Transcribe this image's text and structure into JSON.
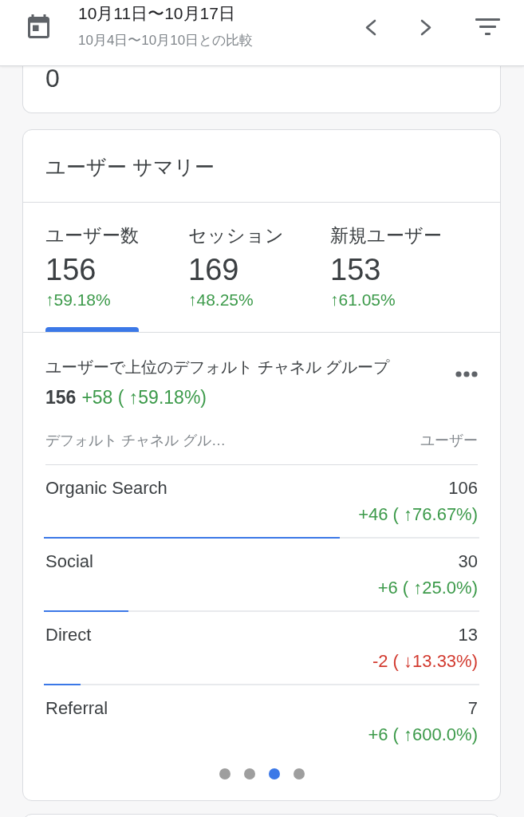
{
  "header": {
    "title": "10月11日〜10月17日",
    "subtitle": "10月4日〜10月10日との比較"
  },
  "previous_card": {
    "value": "0"
  },
  "summary": {
    "title": "ユーザー サマリー",
    "metrics": [
      {
        "label": "ユーザー数",
        "value": "156",
        "change": "↑59.18%",
        "kind": "increase",
        "selected": true
      },
      {
        "label": "セッション",
        "value": "169",
        "change": "↑48.25%",
        "kind": "increase",
        "selected": false
      },
      {
        "label": "新規ユーザー",
        "value": "153",
        "change": "↑61.05%",
        "kind": "increase",
        "selected": false
      }
    ],
    "chart_title": "ユーザーで上位のデフォルト チャネル グループ",
    "total": {
      "value": "156",
      "change": "+58 ( ↑59.18%)",
      "kind": "increase"
    },
    "table": {
      "columns": [
        "デフォルト チャネル グル…",
        "ユーザー"
      ],
      "rows": [
        {
          "channel": "Organic Search",
          "users": "106",
          "change": "+46 ( ↑76.67%)",
          "kind": "increase",
          "level": 0.68
        },
        {
          "channel": "Social",
          "users": "30",
          "change": "+6 ( ↑25.0%)",
          "kind": "increase",
          "level": 0.195
        },
        {
          "channel": "Direct",
          "users": "13",
          "change": "-2 ( ↓13.33%)",
          "kind": "decrease",
          "level": 0.084
        },
        {
          "channel": "Referral",
          "users": "7",
          "change": "+6 ( ↑600.0%)",
          "kind": "increase"
        }
      ]
    },
    "pages": [
      {
        "selected": false
      },
      {
        "selected": false
      },
      {
        "selected": true
      },
      {
        "selected": false
      }
    ]
  }
}
